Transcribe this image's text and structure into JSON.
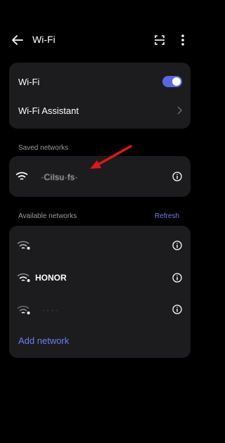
{
  "header": {
    "title": "Wi-Fi"
  },
  "wifi_card": {
    "wifi_label": "Wi-Fi",
    "wifi_enabled": true,
    "assistant_label": "Wi-Fi Assistant"
  },
  "saved": {
    "section_label": "Saved networks",
    "networks": [
      {
        "ssid": "·Cilsu·fs·"
      }
    ]
  },
  "available": {
    "section_label": "Available networks",
    "refresh_label": "Refresh",
    "networks": [
      {
        "ssid": ""
      },
      {
        "ssid": "HONOR"
      },
      {
        "ssid": "· · · ·"
      }
    ],
    "add_label": "Add network"
  },
  "colors": {
    "accent": "#6f7ef0",
    "toggle_on": "#5b67e0",
    "card_bg": "#1c1c1e",
    "background": "#000000"
  },
  "icons": {
    "back": "arrow-left-icon",
    "scan": "qr-scan-icon",
    "more": "more-vertical-icon",
    "chevron": "chevron-right-icon",
    "info": "info-icon",
    "wifi": "wifi-icon"
  }
}
